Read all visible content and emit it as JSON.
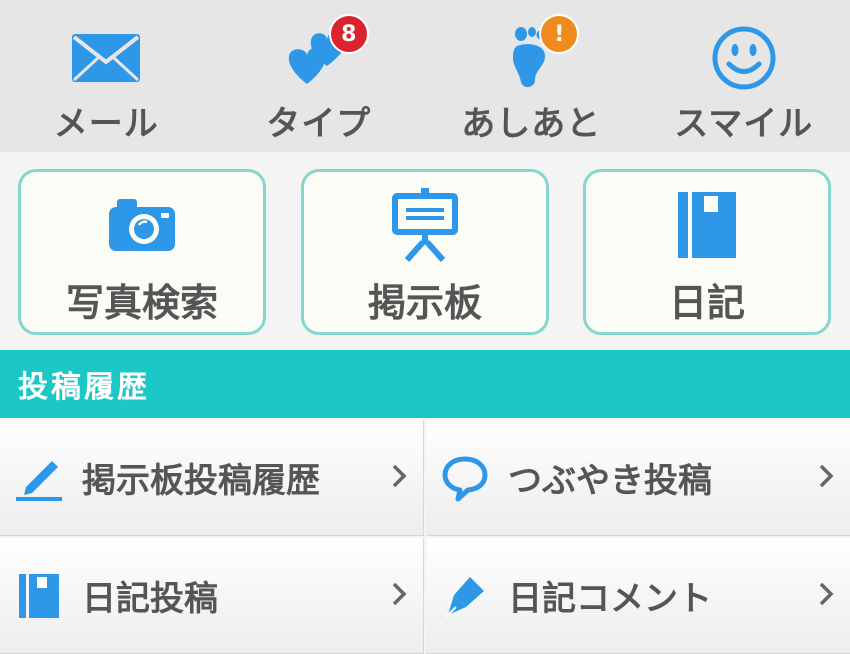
{
  "top_nav": {
    "items": [
      {
        "label": "メール",
        "icon": "mail-icon"
      },
      {
        "label": "タイプ",
        "icon": "hearts-icon",
        "badge": "8",
        "badge_color": "#d9232e"
      },
      {
        "label": "あしあと",
        "icon": "footprint-icon",
        "badge": "!",
        "badge_color": "#f08a1c"
      },
      {
        "label": "スマイル",
        "icon": "smile-icon"
      }
    ]
  },
  "features": {
    "items": [
      {
        "label": "写真検索",
        "icon": "camera-icon"
      },
      {
        "label": "掲示板",
        "icon": "board-icon"
      },
      {
        "label": "日記",
        "icon": "notebook-icon"
      }
    ]
  },
  "section": {
    "title": "投稿履歴"
  },
  "history": {
    "items": [
      {
        "label": "掲示板投稿履歴",
        "icon": "pen-icon"
      },
      {
        "label": "つぶやき投稿",
        "icon": "speech-bubble-icon"
      },
      {
        "label": "日記投稿",
        "icon": "notebook-icon"
      },
      {
        "label": "日記コメント",
        "icon": "fountain-pen-icon"
      }
    ]
  },
  "colors": {
    "accent": "#1cc8c6",
    "icon_blue": "#2f97e8",
    "border": "#86d6cf",
    "text": "#555555"
  }
}
